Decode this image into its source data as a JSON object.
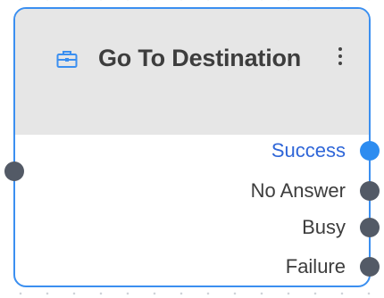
{
  "node": {
    "title": "Go To Destination",
    "icon": "briefcase-icon",
    "menu_icon": "kebab-menu-icon",
    "accent_color": "#3b8ff0"
  },
  "outputs": [
    {
      "label": "Success",
      "active": true
    },
    {
      "label": "No Answer",
      "active": false
    },
    {
      "label": "Busy",
      "active": false
    },
    {
      "label": "Failure",
      "active": false
    }
  ]
}
